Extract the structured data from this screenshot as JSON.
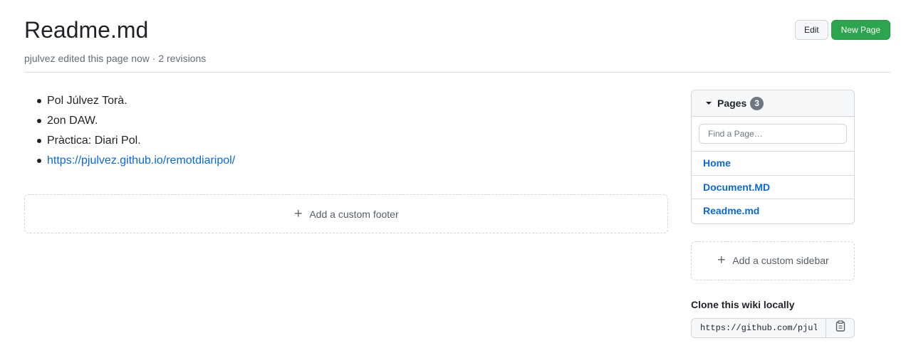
{
  "header": {
    "title": "Readme.md",
    "meta": "pjulvez edited this page now · 2 revisions"
  },
  "actions": {
    "edit_label": "Edit",
    "new_page_label": "New Page"
  },
  "content": {
    "bullets": [
      "Pol Júlvez Torà.",
      "2on DAW.",
      "Pràctica: Diari Pol."
    ],
    "link": "https://pjulvez.github.io/remotdiaripol/",
    "add_footer_label": "Add a custom footer"
  },
  "sidebar": {
    "pages_label": "Pages",
    "pages_count": "3",
    "find_placeholder": "Find a Page…",
    "pages": [
      "Home",
      "Document.MD",
      "Readme.md"
    ],
    "add_sidebar_label": "Add a custom sidebar",
    "clone_title": "Clone this wiki locally",
    "clone_url": "https://github.com/pjulvez/remotdiaripol.wiki.git"
  },
  "icons": {
    "plus": "plus-icon",
    "copy": "clipboard-icon",
    "caret": "triangle-down-icon"
  },
  "colors": {
    "primary_button": "#2da44e",
    "link": "#0969da",
    "count_badge": "#6e7781"
  }
}
